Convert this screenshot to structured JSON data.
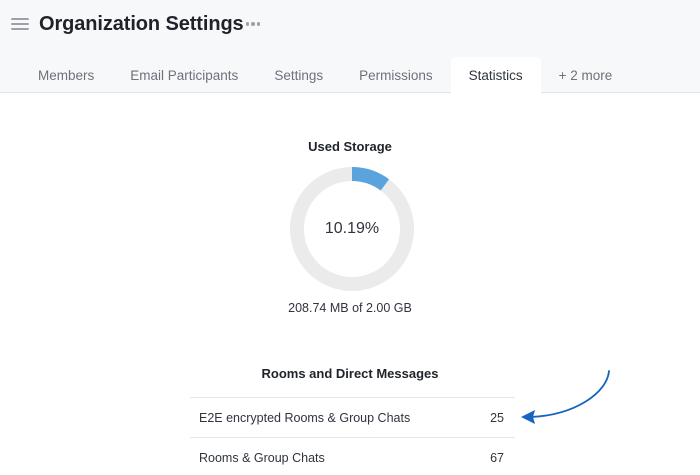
{
  "header": {
    "title": "Organization Settings",
    "menu_icon": "hamburger-menu-icon",
    "more_icon": "kebab-horizontal-icon"
  },
  "tabs": [
    {
      "label": "Members",
      "active": false
    },
    {
      "label": "Email Participants",
      "active": false
    },
    {
      "label": "Settings",
      "active": false
    },
    {
      "label": "Permissions",
      "active": false
    },
    {
      "label": "Statistics",
      "active": true
    },
    {
      "label": "+ 2 more",
      "active": false
    }
  ],
  "storage": {
    "title": "Used Storage",
    "percent_label": "10.19%",
    "percent_value": 10.19,
    "detail": "208.74 MB of 2.00 GB",
    "fill_color": "#5ba3dd",
    "track_color": "#ebebeb"
  },
  "rooms": {
    "title": "Rooms and Direct Messages",
    "rows": [
      {
        "label": "E2E encrypted Rooms & Group Chats",
        "value": "25"
      },
      {
        "label": "Rooms & Group Chats",
        "value": "67"
      }
    ]
  },
  "annotation": {
    "arrow_color": "#1565c0"
  }
}
